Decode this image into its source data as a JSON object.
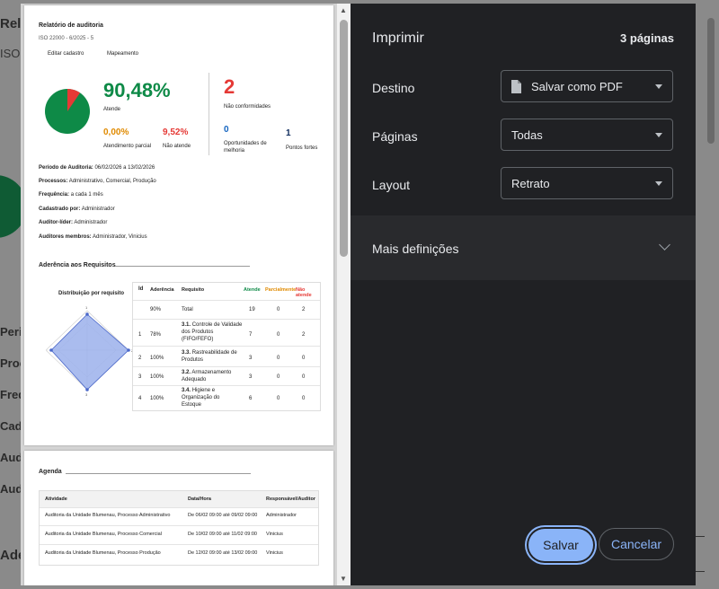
{
  "background": {
    "title": "Rel",
    "sub": "ISO",
    "items": [
      "Peri",
      "Proc",
      "Freq",
      "Cad",
      "Aud",
      "Aud",
      "Ade"
    ]
  },
  "report": {
    "title": "Relatório de auditoria",
    "subtitle": "ISO 22000 - 6/2025 - 5",
    "tabs": [
      "Editar cadastro",
      "Mapeamento"
    ],
    "pie": {
      "atende_fraction": 0.9048,
      "not_fraction": 0.0952,
      "colors": {
        "atende": "#0e8a47",
        "nao": "#e53935"
      }
    },
    "percent_main": "90,48%",
    "percent_main_label": "Atende",
    "parcial_value": "0,00%",
    "parcial_label": "Atendimento parcial",
    "nao_value": "9,52%",
    "nao_label": "Não atende",
    "nc_value": "2",
    "nc_label": "Não conformidades",
    "om_value": "0",
    "om_label": "Oportunidades de melhoria",
    "pf_value": "1",
    "pf_label": "Pontos fortes",
    "details": [
      {
        "label": "Período de Auditoria:",
        "value": "06/02/2026 a 13/02/2026"
      },
      {
        "label": "Processos:",
        "value": "Administrativo, Comercial, Produção"
      },
      {
        "label": "Frequência:",
        "value": "a cada 1 mês"
      },
      {
        "label": "Cadastrado por:",
        "value": "Administrador"
      },
      {
        "label": "Auditor-líder:",
        "value": "Administrador"
      },
      {
        "label": "Auditores membros:",
        "value": "Administrador, Vinicius"
      }
    ],
    "section_adherence": "Aderência aos Requisitos",
    "radar_title": "Distribuição por requisito",
    "radar_labels": [
      "1",
      "2",
      "3",
      "4"
    ],
    "table_headers": [
      "Id",
      "Aderência",
      "Requisito",
      "Atende",
      "Parcialmente",
      "Não atende"
    ],
    "table_rows": [
      {
        "id": "",
        "aderencia": "90%",
        "num": "",
        "requisito": "Total",
        "atende": "19",
        "parcial": "0",
        "nao": "2"
      },
      {
        "id": "1",
        "aderencia": "78%",
        "num": "3.1.",
        "requisito": "Controle de Validade dos Produtos (FIFO/FEFO)",
        "atende": "7",
        "parcial": "0",
        "nao": "2"
      },
      {
        "id": "2",
        "aderencia": "100%",
        "num": "3.3.",
        "requisito": "Rastreabilidade de Produtos",
        "atende": "3",
        "parcial": "0",
        "nao": "0"
      },
      {
        "id": "3",
        "aderencia": "100%",
        "num": "3.2.",
        "requisito": "Armazenamento Adequado",
        "atende": "3",
        "parcial": "0",
        "nao": "0"
      },
      {
        "id": "4",
        "aderencia": "100%",
        "num": "3.4.",
        "requisito": "Higiene e Organização do Estoque",
        "atende": "6",
        "parcial": "0",
        "nao": "0"
      }
    ],
    "agenda_title": "Agenda",
    "agenda_headers": [
      "Atividade",
      "Data/Hora",
      "Responsável/Auditor"
    ],
    "agenda_rows": [
      {
        "atividade": "Auditoria da Unidade Blumenau, Processo Administrativo",
        "data": "De 06/02 09:00 até 09/02 09:00",
        "resp": "Administrador"
      },
      {
        "atividade": "Auditoria da Unidade Blumenau, Processo Comercial",
        "data": "De 10/02 09:00 até 11/02 09:00",
        "resp": "Vinicius"
      },
      {
        "atividade": "Auditoria da Unidade Blumenau, Processo Produção",
        "data": "De 12/02 09:00 até 13/02 09:00",
        "resp": "Vinicius"
      }
    ],
    "colors": {
      "green": "#0e8a47",
      "red": "#e53935",
      "orange": "#e08a00",
      "blue": "#1565c0"
    }
  },
  "dialog": {
    "title": "Imprimir",
    "pages_count": "3 páginas",
    "destination_label": "Destino",
    "destination_value": "Salvar como PDF",
    "pages_label": "Páginas",
    "pages_value": "Todas",
    "layout_label": "Layout",
    "layout_value": "Retrato",
    "more_settings": "Mais definições",
    "save": "Salvar",
    "cancel": "Cancelar"
  }
}
